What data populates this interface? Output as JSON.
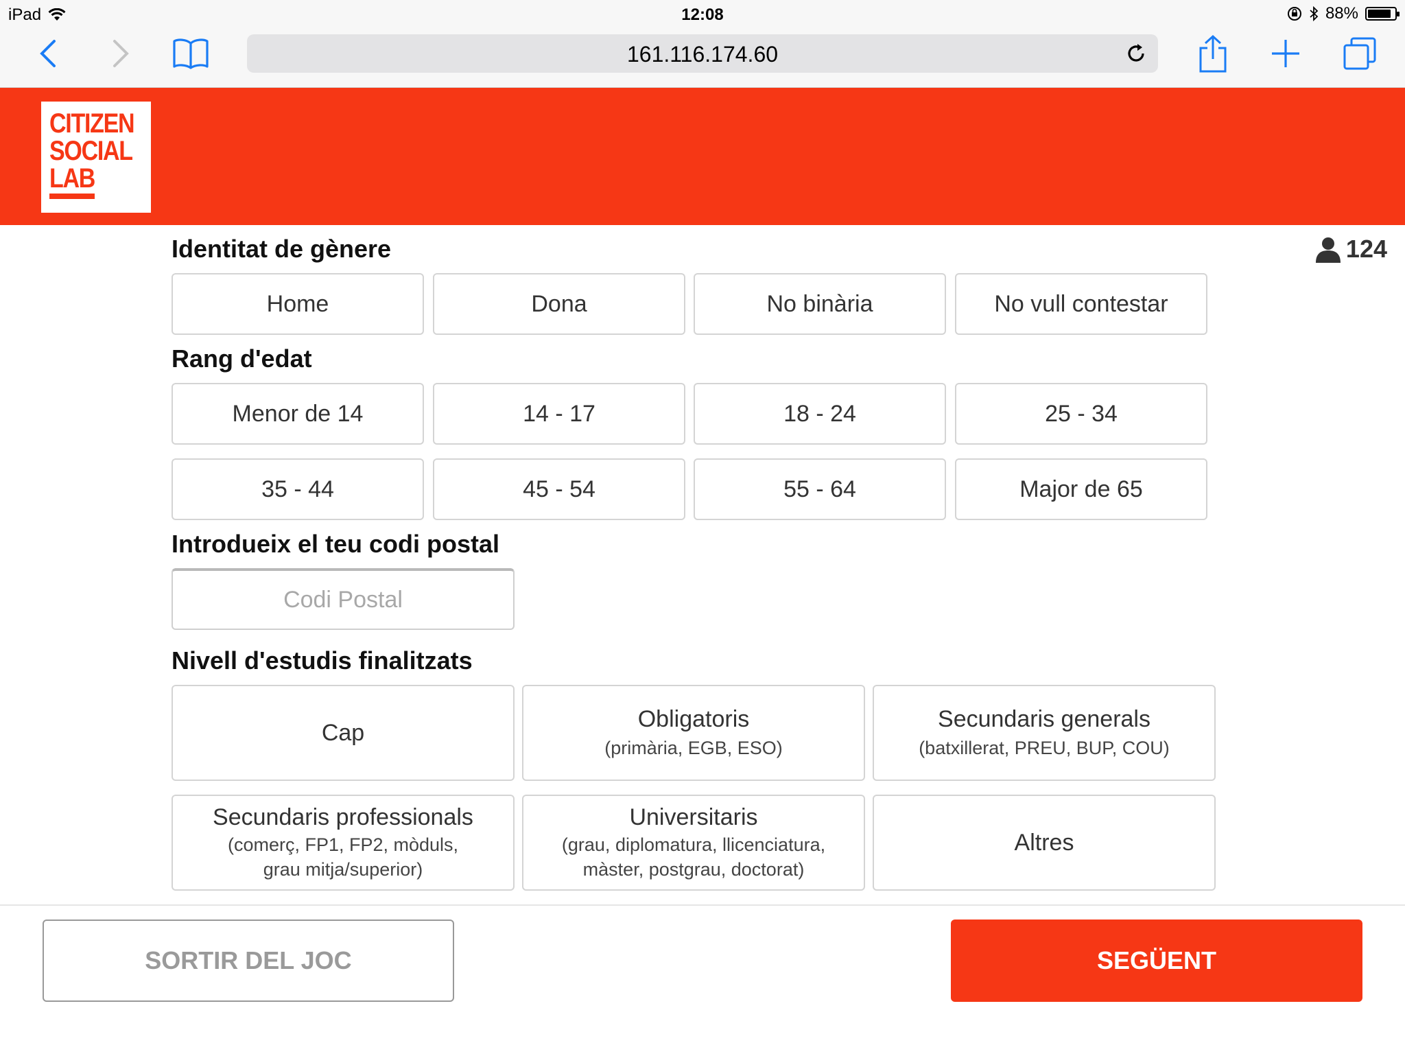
{
  "status_bar": {
    "device": "iPad",
    "time": "12:08",
    "battery": "88%",
    "battery_level": 0.88
  },
  "browser": {
    "url": "161.116.174.60",
    "icons": [
      "back-icon",
      "forward-icon",
      "bookmarks-icon",
      "reload-icon",
      "share-icon",
      "new-tab-icon",
      "tabs-icon"
    ]
  },
  "header": {
    "logo_lines": [
      "CITIZEN",
      "SOCIAL",
      "LAB"
    ],
    "brand_color": "#f63715"
  },
  "players": {
    "count": "124",
    "icon": "person-icon"
  },
  "gender": {
    "title": "Identitat de gènere",
    "options": [
      "Home",
      "Dona",
      "No binària",
      "No vull contestar"
    ]
  },
  "age": {
    "title": "Rang d'edat",
    "options": [
      "Menor de 14",
      "14 - 17",
      "18 - 24",
      "25 - 34",
      "35 - 44",
      "45 - 54",
      "55 - 64",
      "Major de 65"
    ]
  },
  "postal": {
    "title": "Introdueix el teu codi postal",
    "placeholder": "Codi Postal",
    "value": ""
  },
  "education": {
    "title": "Nivell d'estudis finalitzats",
    "options": [
      {
        "label": "Cap",
        "detail": ""
      },
      {
        "label": "Obligatoris",
        "detail": "(primària, EGB, ESO)"
      },
      {
        "label": "Secundaris generals",
        "detail": "(batxillerat, PREU, BUP, COU)"
      },
      {
        "label": "Secundaris professionals",
        "detail": "(comerç, FP1, FP2, mòduls,",
        "detail2": "grau mitja/superior)"
      },
      {
        "label": "Universitaris",
        "detail": "(grau, diplomatura, llicenciatura,",
        "detail2": "màster, postgrau, doctorat)"
      },
      {
        "label": "Altres",
        "detail": ""
      }
    ]
  },
  "footer": {
    "exit_label": "SORTIR DEL JOC",
    "next_label": "SEGÜENT"
  }
}
